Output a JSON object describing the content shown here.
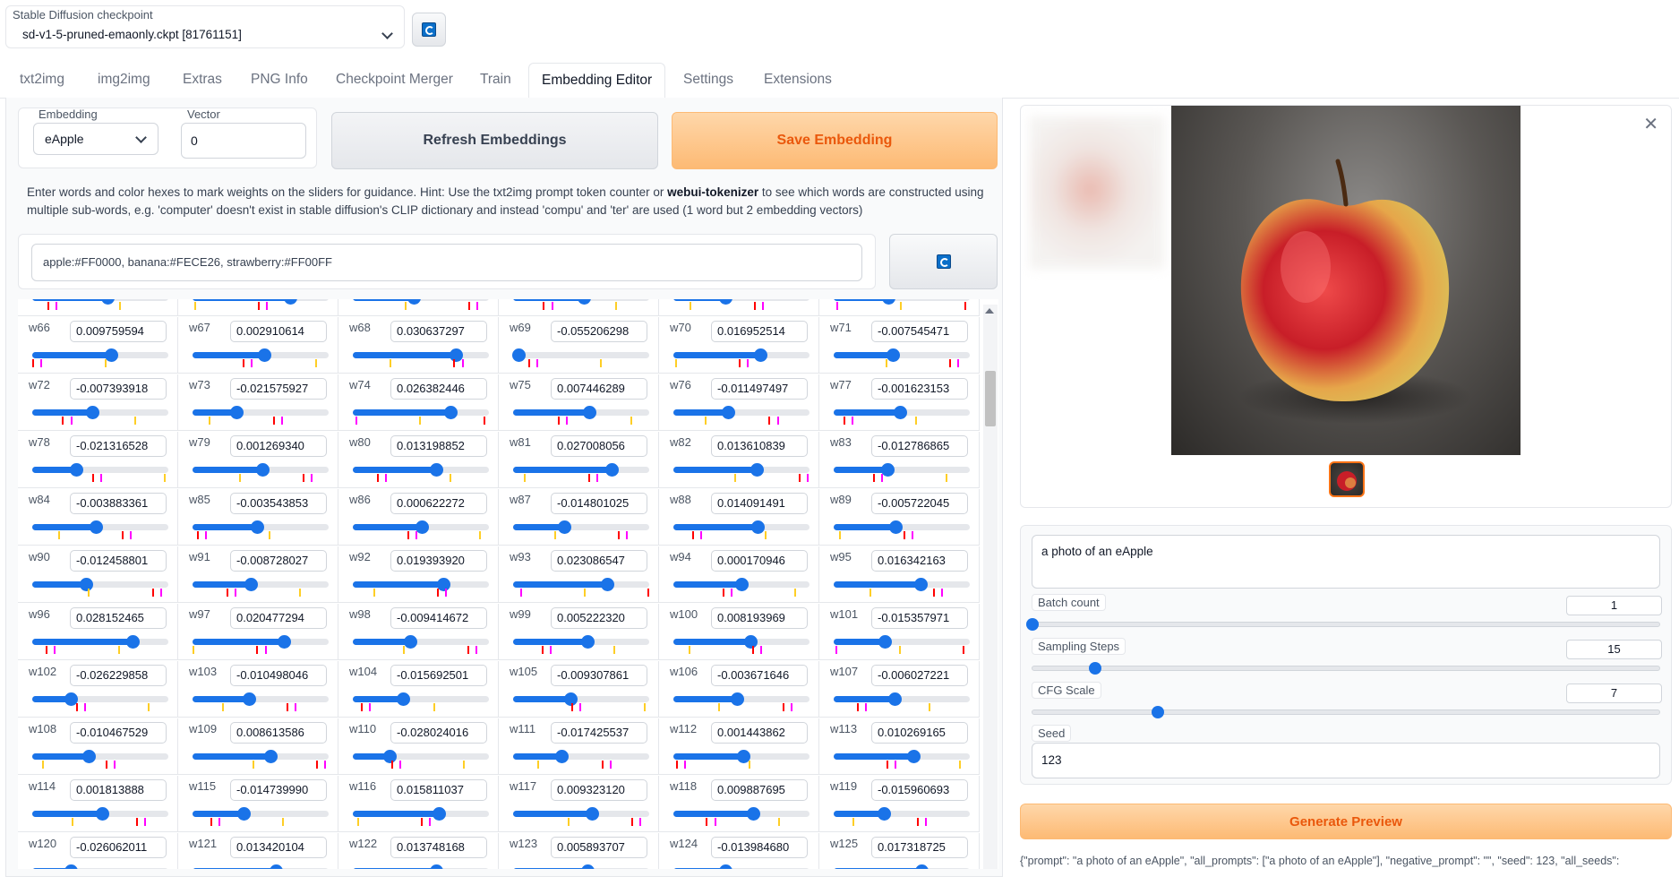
{
  "checkpoint": {
    "label": "Stable Diffusion checkpoint",
    "value": "sd-v1-5-pruned-emaonly.ckpt [81761151]"
  },
  "tabs": [
    "txt2img",
    "img2img",
    "Extras",
    "PNG Info",
    "Checkpoint Merger",
    "Train",
    "Embedding Editor",
    "Settings",
    "Extensions"
  ],
  "active_tab": "Embedding Editor",
  "editor": {
    "embedding_label": "Embedding",
    "embedding_value": "eApple",
    "vector_label": "Vector",
    "vector_value": "0",
    "refresh_label": "Refresh Embeddings",
    "save_label": "Save Embedding",
    "hint_part1": "Enter words and color hexes to mark weights on the sliders for guidance. Hint: Use the txt2img prompt token counter or ",
    "hint_bold": "webui-tokenizer",
    "hint_part2": " to see which words are constructed using multiple sub-words, e.g. 'computer' doesn't exist in stable diffusion's CLIP dictionary and instead 'compu' and 'ter' are used (1 word but 2 embedding vectors)",
    "colors_value": "apple:#FF0000, banana:#FECE26, strawberry:#FF00FF",
    "accent_color": "#1a73e8",
    "guide_colors": [
      "#FF0000",
      "#FECE26",
      "#FF00FF"
    ]
  },
  "weights": [
    {
      "label": "w66",
      "value": "0.009759594"
    },
    {
      "label": "w67",
      "value": "0.002910614"
    },
    {
      "label": "w68",
      "value": "0.030637297"
    },
    {
      "label": "w69",
      "value": "-0.055206298"
    },
    {
      "label": "w70",
      "value": "0.016952514"
    },
    {
      "label": "w71",
      "value": "-0.007545471"
    },
    {
      "label": "w72",
      "value": "-0.007393918"
    },
    {
      "label": "w73",
      "value": "-0.021575927"
    },
    {
      "label": "w74",
      "value": "0.026382446"
    },
    {
      "label": "w75",
      "value": "0.007446289"
    },
    {
      "label": "w76",
      "value": "-0.011497497"
    },
    {
      "label": "w77",
      "value": "-0.001623153"
    },
    {
      "label": "w78",
      "value": "-0.021316528"
    },
    {
      "label": "w79",
      "value": "0.001269340"
    },
    {
      "label": "w80",
      "value": "0.013198852"
    },
    {
      "label": "w81",
      "value": "0.027008056"
    },
    {
      "label": "w82",
      "value": "0.013610839"
    },
    {
      "label": "w83",
      "value": "-0.012786865"
    },
    {
      "label": "w84",
      "value": "-0.003883361"
    },
    {
      "label": "w85",
      "value": "-0.003543853"
    },
    {
      "label": "w86",
      "value": "0.000622272"
    },
    {
      "label": "w87",
      "value": "-0.014801025"
    },
    {
      "label": "w88",
      "value": "0.014091491"
    },
    {
      "label": "w89",
      "value": "-0.005722045"
    },
    {
      "label": "w90",
      "value": "-0.012458801"
    },
    {
      "label": "w91",
      "value": "-0.008728027"
    },
    {
      "label": "w92",
      "value": "0.019393920"
    },
    {
      "label": "w93",
      "value": "0.023086547"
    },
    {
      "label": "w94",
      "value": "0.000170946"
    },
    {
      "label": "w95",
      "value": "0.016342163"
    },
    {
      "label": "w96",
      "value": "0.028152465"
    },
    {
      "label": "w97",
      "value": "0.020477294"
    },
    {
      "label": "w98",
      "value": "-0.009414672"
    },
    {
      "label": "w99",
      "value": "0.005222320"
    },
    {
      "label": "w100",
      "value": "0.008193969"
    },
    {
      "label": "w101",
      "value": "-0.015357971"
    },
    {
      "label": "w102",
      "value": "-0.026229858"
    },
    {
      "label": "w103",
      "value": "-0.010498046"
    },
    {
      "label": "w104",
      "value": "-0.015692501"
    },
    {
      "label": "w105",
      "value": "-0.009307861"
    },
    {
      "label": "w106",
      "value": "-0.003671646"
    },
    {
      "label": "w107",
      "value": "-0.006027221"
    },
    {
      "label": "w108",
      "value": "-0.010467529"
    },
    {
      "label": "w109",
      "value": "0.008613586"
    },
    {
      "label": "w110",
      "value": "-0.028024016"
    },
    {
      "label": "w111",
      "value": "-0.017425537"
    },
    {
      "label": "w112",
      "value": "0.001443862"
    },
    {
      "label": "w113",
      "value": "0.010269165"
    },
    {
      "label": "w114",
      "value": "0.001813888"
    },
    {
      "label": "w115",
      "value": "-0.014739990"
    },
    {
      "label": "w116",
      "value": "0.015811037"
    },
    {
      "label": "w117",
      "value": "0.009323120"
    },
    {
      "label": "w118",
      "value": "0.009887695"
    },
    {
      "label": "w119",
      "value": "-0.015960693"
    },
    {
      "label": "w120",
      "value": "-0.026062011"
    },
    {
      "label": "w121",
      "value": "0.013420104"
    },
    {
      "label": "w122",
      "value": "0.013748168"
    },
    {
      "label": "w123",
      "value": "0.005893707"
    },
    {
      "label": "w124",
      "value": "-0.013984680"
    },
    {
      "label": "w125",
      "value": "0.017318725"
    }
  ],
  "partial_top_row_fill": [
    0.55,
    0.72,
    0.45,
    0.52,
    0.38,
    0.4
  ],
  "preview": {
    "prompt": "a photo of an eApple",
    "batch_count_label": "Batch count",
    "batch_count": "1",
    "batch_count_fraction": 0.0,
    "steps_label": "Sampling Steps",
    "steps": "15",
    "steps_fraction": 0.1,
    "cfg_label": "CFG Scale",
    "cfg": "7",
    "cfg_fraction": 0.2,
    "seed_label": "Seed",
    "seed": "123",
    "generate_label": "Generate Preview",
    "json_output": "{\"prompt\": \"a photo of an eApple\", \"all_prompts\": [\"a photo of an eApple\"], \"negative_prompt\": \"\", \"seed\": 123, \"all_seeds\":"
  }
}
